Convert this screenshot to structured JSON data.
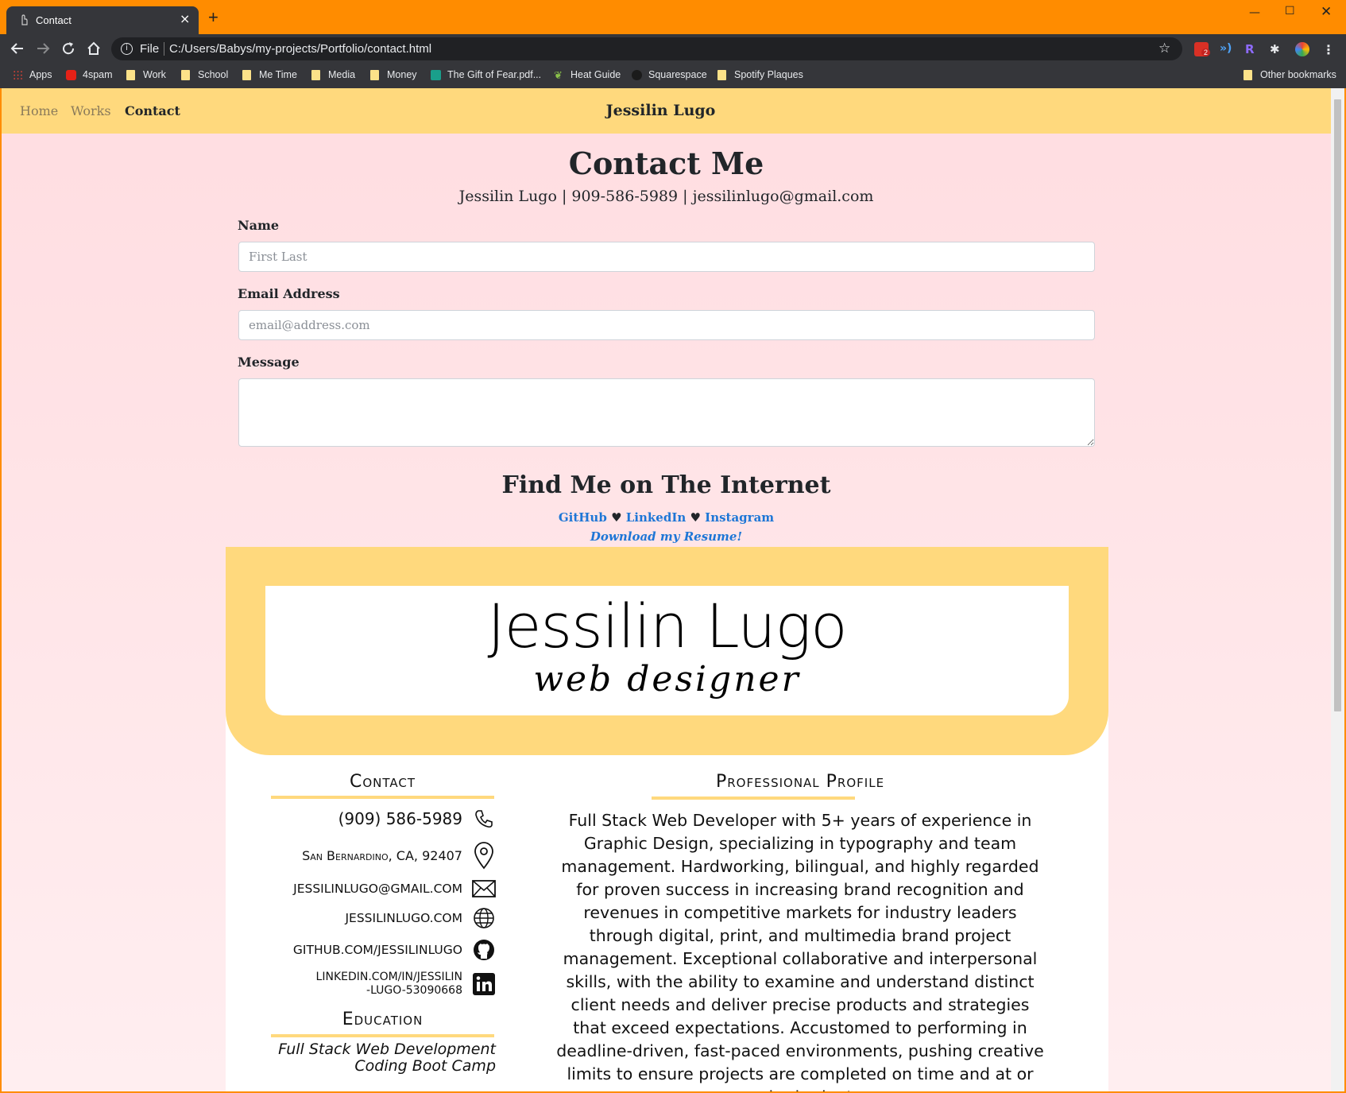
{
  "browser": {
    "tab_title": "Contact",
    "tab_close": "×",
    "new_tab": "+",
    "url_protocol": "File",
    "url": "C:/Users/Babys/my-projects/Portfolio/contact.html",
    "gmail_badge": "2",
    "bookmarks": [
      "Apps",
      "4spam",
      "Work",
      "School",
      "Me Time",
      "Media",
      "Money",
      "The Gift of Fear.pdf...",
      "Heat Guide",
      "Squarespace",
      "Spotify Plaques"
    ],
    "other_bookmarks": "Other bookmarks"
  },
  "site": {
    "nav": {
      "home": "Home",
      "works": "Works",
      "contact": "Contact"
    },
    "brand": "Jessilin Lugo"
  },
  "contact": {
    "title": "Contact Me",
    "line": "Jessilin Lugo | 909-586-5989 | jessilinlugo@gmail.com",
    "name_label": "Name",
    "name_placeholder": "First Last",
    "email_label": "Email Address",
    "email_placeholder": "email@address.com",
    "message_label": "Message",
    "message_value": ""
  },
  "find_me": {
    "title": "Find Me on The Internet",
    "links": [
      "GitHub",
      "LinkedIn",
      "Instagram"
    ],
    "separator": "♥",
    "resume": "Download my Resume!"
  },
  "resume": {
    "logo_name": "Jessilin Lugo",
    "logo_sub": "web designer",
    "contact_heading": "Contact",
    "phone": "(909) 586-5989",
    "location": "San Bernardino, CA, 92407",
    "email": "JESSILINLUGO@GMAIL.COM",
    "website": "JESSILINLUGO.COM",
    "github": "GITHUB.COM/JESSILINLUGO",
    "linkedin_1": "LINKEDIN.COM/IN/JESSILIN",
    "linkedin_2": "-LUGO-53090668",
    "education_heading": "Education",
    "edu_1": "Full Stack Web Development",
    "edu_2": "Coding Boot Camp",
    "profile_heading": "Professional Profile",
    "profile_text": "Full Stack Web Developer with 5+ years of experience in Graphic Design, specializing in typography and team management. Hardworking, bilingual, and highly regarded for proven success in increasing brand recognition and revenues in competitive markets for industry leaders through digital, print, and multimedia brand project management. Exceptional collaborative and interpersonal skills, with the ability to examine and understand distinct client needs and deliver precise products and strategies that exceed expectations. Accustomed to performing in deadline-driven, fast-paced environments, pushing creative limits to ensure projects are completed on time and at or under budget."
  },
  "colors": {
    "chrome_frame": "#ff8c00",
    "nav_bg": "#ffd97d",
    "page_bg": "#ffdde1",
    "link": "#1e76d6"
  }
}
